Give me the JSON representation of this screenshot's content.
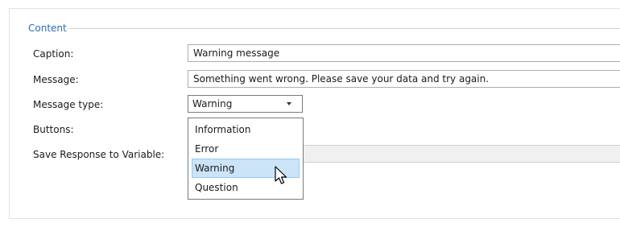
{
  "group": {
    "title": "Content"
  },
  "labels": {
    "caption": "Caption:",
    "message": "Message:",
    "message_type": "Message type:",
    "buttons": "Buttons:",
    "save_response": "Save Response to Variable:"
  },
  "fields": {
    "caption_value": "Warning message",
    "message_value": "Something went wrong. Please save your data and try again.",
    "save_response_value": ""
  },
  "message_type": {
    "selected": "Warning",
    "options": [
      "Information",
      "Error",
      "Warning",
      "Question"
    ],
    "hovered_option": "Warning"
  },
  "colors": {
    "group_title": "#2d6db5",
    "hover_background": "#cce4f7",
    "hover_border": "#99c9ef"
  }
}
